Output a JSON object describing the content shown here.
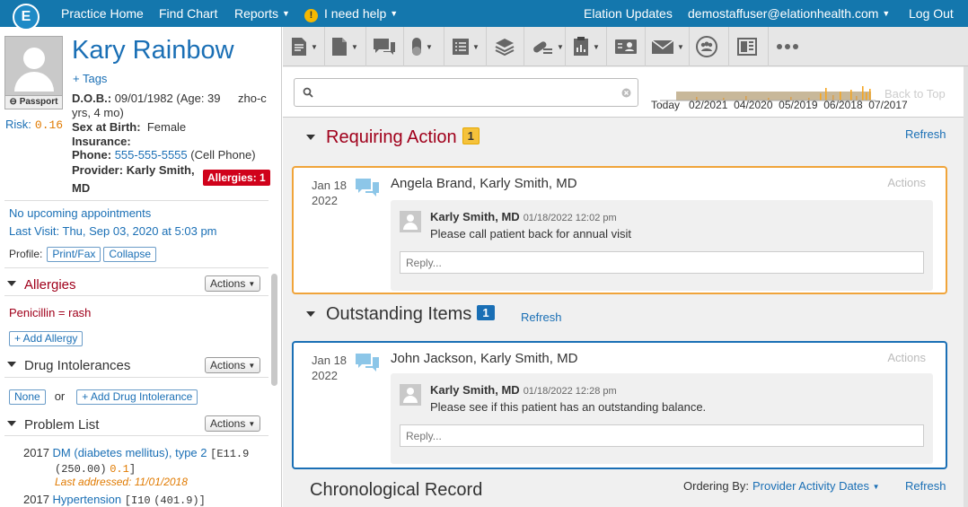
{
  "topnav": {
    "logo": "E",
    "items": [
      "Practice Home",
      "Find Chart",
      "Reports",
      "I need help"
    ],
    "right": [
      "Elation Updates",
      "demostaffuser@elationhealth.com",
      "Log Out"
    ]
  },
  "patient": {
    "name": "Kary Rainbow",
    "tags": "+ Tags",
    "passport": "Passport",
    "dob_label": "D.O.B.:",
    "dob_line1": "09/01/1982 (Age: 39",
    "dob_line2": "yrs, 4 mo)",
    "language": "zho-c",
    "sex_label": "Sex at Birth:",
    "sex": "Female",
    "insurance_label": "Insurance:",
    "phone_label": "Phone:",
    "phone": "555-555-5555",
    "phone_type": "(Cell Phone)",
    "provider_label": "Provider:",
    "provider_1": "Karly Smith,",
    "provider_2": "MD",
    "allergies_badge": "Allergies: 1",
    "risk_label": "Risk:",
    "risk_value": "0.16"
  },
  "visits": {
    "upcoming": "No upcoming appointments",
    "last_visit": "Last Visit: Thu, Sep 03, 2020 at 5:03 pm",
    "profile_label": "Profile:",
    "print_fax": "Print/Fax",
    "collapse": "Collapse"
  },
  "allergies": {
    "title": "Allergies",
    "actions": "Actions",
    "item": "Penicillin = rash",
    "add": "+ Add Allergy"
  },
  "intolerances": {
    "title": "Drug Intolerances",
    "actions": "Actions",
    "none": "None",
    "or": "or",
    "add": "+ Add Drug Intolerance"
  },
  "problems": {
    "title": "Problem List",
    "actions": "Actions",
    "items": [
      {
        "year": "2017",
        "name": "DM (diabetes mellitus), type 2",
        "code1": "[E11.9",
        "code2": "(250.00)",
        "score": "0.1",
        "code_end": "]",
        "addressed": "Last addressed: 11/01/2018"
      },
      {
        "year": "2017",
        "name": "Hypertension",
        "code1": "[I10",
        "code2": "(401.9)]"
      }
    ]
  },
  "search": {
    "placeholder": ""
  },
  "timeline": {
    "labels": [
      "Today",
      "02/2021",
      "04/2020",
      "05/2019",
      "06/2018",
      "07/2017"
    ],
    "back_to_top": "Back to Top"
  },
  "requiring": {
    "title": "Requiring Action",
    "count": "1",
    "refresh": "Refresh",
    "card": {
      "date1": "Jan 18",
      "date2": "2022",
      "title": "Angela Brand, Karly Smith, MD",
      "actions": "Actions",
      "sender": "Karly Smith, MD",
      "timestamp": "01/18/2022 12:02 pm",
      "message": "Please call patient back for annual visit",
      "reply_placeholder": "Reply..."
    }
  },
  "outstanding": {
    "title": "Outstanding Items",
    "count": "1",
    "refresh": "Refresh",
    "card": {
      "date1": "Jan 18",
      "date2": "2022",
      "title": "John Jackson, Karly Smith, MD",
      "actions": "Actions",
      "sender": "Karly Smith, MD",
      "timestamp": "01/18/2022 12:28 pm",
      "message": "Please see if this patient has an outstanding balance.",
      "reply_placeholder": "Reply..."
    }
  },
  "chronological": {
    "title": "Chronological Record",
    "ordering_label": "Ordering By:",
    "ordering_value": "Provider Activity Dates",
    "refresh": "Refresh"
  },
  "colors": {
    "nav": "#1477ad",
    "link": "#1a6fb5",
    "requiring_border": "#f0a43a",
    "outstanding_border": "#1a6fb5",
    "danger": "#d0021b"
  }
}
